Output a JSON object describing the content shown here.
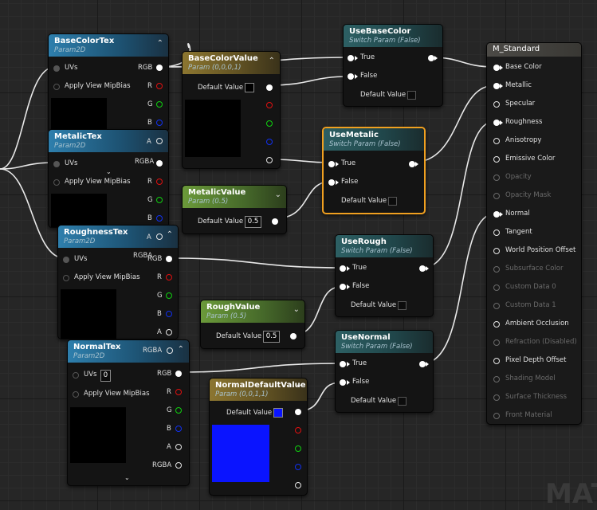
{
  "watermark": "MAT",
  "colors": {
    "blue_default": "#0a14ff",
    "selection": "#f0a020"
  },
  "nodes": {
    "base_color_tex": {
      "title": "BaseColorTex",
      "subtitle": "Param2D",
      "uvs": "UVs",
      "apply": "Apply View MipBias",
      "rgb": "RGB",
      "r": "R",
      "g": "G",
      "b": "B",
      "a": "A",
      "rgba": "RGBA"
    },
    "metalic_tex": {
      "title": "MetalicTex",
      "subtitle": "Param2D",
      "uvs": "UVs",
      "apply": "Apply View MipBias",
      "r": "R",
      "g": "G",
      "b": "B"
    },
    "roughness_tex": {
      "title": "RoughnessTex",
      "subtitle": "Param2D",
      "uvs": "UVs",
      "apply": "Apply View MipBias",
      "rgb": "RGB",
      "r": "R",
      "g": "G",
      "b": "B",
      "a": "A",
      "overlay_a": "A",
      "overlay_rgba": "RGBA"
    },
    "normal_tex": {
      "title": "NormalTex",
      "subtitle": "Param2D",
      "uvs": "UVs",
      "uvs_value": "0",
      "apply": "Apply View MipBias",
      "rgb": "RGB",
      "r": "R",
      "g": "G",
      "b": "B",
      "a": "A",
      "rgba": "RGBA",
      "overlay_rgba": "RGBA"
    },
    "base_color_value": {
      "title": "BaseColorValue",
      "subtitle": "Param (0,0,0,1)",
      "default_label": "Default Value"
    },
    "metalic_value": {
      "title": "MetalicValue",
      "subtitle": "Param (0.5)",
      "default_label": "Default Value",
      "value": "0.5"
    },
    "rough_value": {
      "title": "RoughValue",
      "subtitle": "Param (0.5)",
      "default_label": "Default Value",
      "value": "0.5"
    },
    "normal_default_value": {
      "title": "NormalDefaultValue",
      "subtitle": "Param (0,0,1,1)",
      "default_label": "Default Value"
    },
    "use_base_color": {
      "title": "UseBaseColor",
      "subtitle": "Switch Param (False)",
      "true": "True",
      "false": "False",
      "default_label": "Default Value"
    },
    "use_metalic": {
      "title": "UseMetalic",
      "subtitle": "Switch Param (False)",
      "true": "True",
      "false": "False",
      "default_label": "Default Value"
    },
    "use_rough": {
      "title": "UseRough",
      "subtitle": "Switch Param (False)",
      "true": "True",
      "false": "False",
      "default_label": "Default Value"
    },
    "use_normal": {
      "title": "UseNormal",
      "subtitle": "Switch Param (False)",
      "true": "True",
      "false": "False",
      "default_label": "Default Value"
    },
    "m_standard": {
      "title": "M_Standard",
      "inputs": [
        {
          "label": "Base Color",
          "enabled": true,
          "connected": true
        },
        {
          "label": "Metallic",
          "enabled": true,
          "connected": true
        },
        {
          "label": "Specular",
          "enabled": true,
          "connected": false
        },
        {
          "label": "Roughness",
          "enabled": true,
          "connected": true
        },
        {
          "label": "Anisotropy",
          "enabled": true,
          "connected": false
        },
        {
          "label": "Emissive Color",
          "enabled": true,
          "connected": false
        },
        {
          "label": "Opacity",
          "enabled": false,
          "connected": false
        },
        {
          "label": "Opacity Mask",
          "enabled": false,
          "connected": false
        },
        {
          "label": "Normal",
          "enabled": true,
          "connected": true
        },
        {
          "label": "Tangent",
          "enabled": true,
          "connected": false
        },
        {
          "label": "World Position Offset",
          "enabled": true,
          "connected": false
        },
        {
          "label": "Subsurface Color",
          "enabled": false,
          "connected": false
        },
        {
          "label": "Custom Data 0",
          "enabled": false,
          "connected": false
        },
        {
          "label": "Custom Data 1",
          "enabled": false,
          "connected": false
        },
        {
          "label": "Ambient Occlusion",
          "enabled": true,
          "connected": false
        },
        {
          "label": "Refraction (Disabled)",
          "enabled": false,
          "connected": false
        },
        {
          "label": "Pixel Depth Offset",
          "enabled": true,
          "connected": false
        },
        {
          "label": "Shading Model",
          "enabled": false,
          "connected": false
        },
        {
          "label": "Surface Thickness",
          "enabled": false,
          "connected": false
        },
        {
          "label": "Front Material",
          "enabled": false,
          "connected": false
        }
      ]
    }
  }
}
